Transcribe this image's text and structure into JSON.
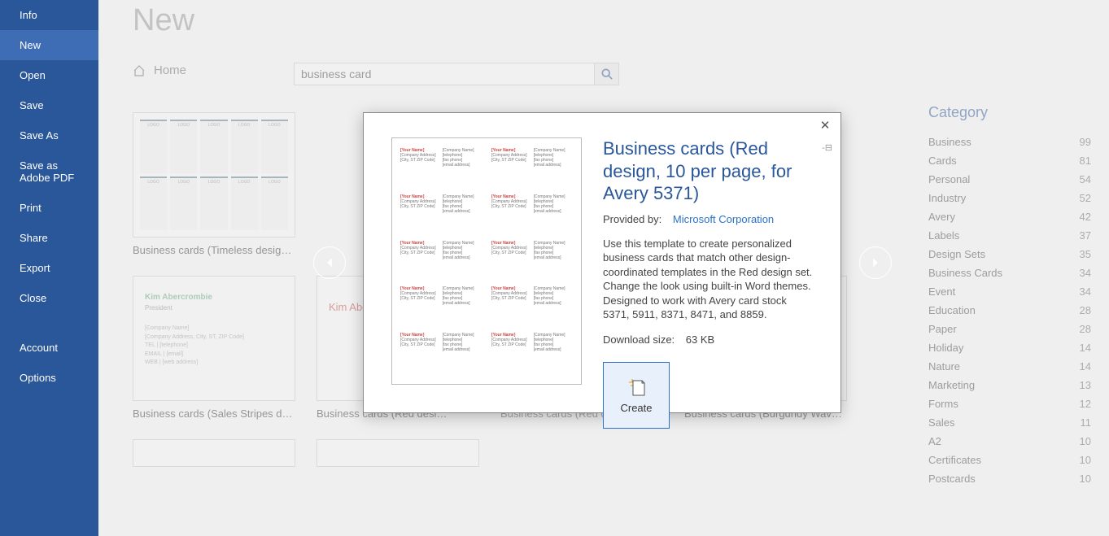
{
  "sidebar": {
    "items": [
      {
        "label": "Info",
        "id": "info"
      },
      {
        "label": "New",
        "id": "new",
        "active": true
      },
      {
        "label": "Open",
        "id": "open"
      },
      {
        "label": "Save",
        "id": "save"
      },
      {
        "label": "Save As",
        "id": "save-as"
      },
      {
        "label": "Save as Adobe PDF",
        "id": "save-adobe-pdf"
      },
      {
        "label": "Print",
        "id": "print"
      },
      {
        "label": "Share",
        "id": "share"
      },
      {
        "label": "Export",
        "id": "export"
      },
      {
        "label": "Close",
        "id": "close"
      }
    ],
    "secondary": [
      {
        "label": "Account",
        "id": "account"
      },
      {
        "label": "Options",
        "id": "options"
      }
    ]
  },
  "page": {
    "title": "New"
  },
  "breadcrumb": {
    "home": "Home"
  },
  "search": {
    "value": "business card"
  },
  "categories": {
    "title": "Category",
    "items": [
      {
        "name": "Business",
        "count": 99
      },
      {
        "name": "Cards",
        "count": 81
      },
      {
        "name": "Personal",
        "count": 54
      },
      {
        "name": "Industry",
        "count": 52
      },
      {
        "name": "Avery",
        "count": 42
      },
      {
        "name": "Labels",
        "count": 37
      },
      {
        "name": "Design Sets",
        "count": 35
      },
      {
        "name": "Business Cards",
        "count": 34
      },
      {
        "name": "Event",
        "count": 34
      },
      {
        "name": "Education",
        "count": 28
      },
      {
        "name": "Paper",
        "count": 28
      },
      {
        "name": "Holiday",
        "count": 14
      },
      {
        "name": "Nature",
        "count": 14
      },
      {
        "name": "Marketing",
        "count": 13
      },
      {
        "name": "Forms",
        "count": 12
      },
      {
        "name": "Sales",
        "count": 11
      },
      {
        "name": "A2",
        "count": 10
      },
      {
        "name": "Certificates",
        "count": 10
      },
      {
        "name": "Postcards",
        "count": 10
      }
    ]
  },
  "gallery": {
    "row1": [
      {
        "caption": "Business cards (Timeless design,…"
      },
      {
        "caption": ""
      },
      {
        "caption": ""
      },
      {
        "caption": ""
      }
    ],
    "row2": [
      {
        "caption": "Business cards (Sales Stripes desi…"
      },
      {
        "caption": "Business cards (Red desi…"
      },
      {
        "caption": "Business cards (Red design, 10 p…",
        "selected": true
      },
      {
        "caption": "Business cards (Burgundy Wave…"
      }
    ]
  },
  "sample": {
    "name": "Kim Abercrombie",
    "role": "President",
    "l1": "[Company Name]",
    "l2": "[Company Address, City, ST, ZIP Code]",
    "l3": "TEL | [telephone]",
    "l4": "EMAIL | [email]",
    "l5": "WEB | [web address]",
    "short": "Kim Abercrombie"
  },
  "modal": {
    "title": "Business cards (Red design, 10 per page, for Avery 5371)",
    "providedByLabel": "Provided by:",
    "provider": "Microsoft Corporation",
    "description": "Use this template to create personalized business cards that match other design-coordinated templates in the Red design set. Change the look using built-in Word themes. Designed to work with Avery card stock 5371, 5911, 8371, 8471, and 8859.",
    "dlLabel": "Download size:",
    "dlSize": "63 KB",
    "createLabel": "Create",
    "previewCell": {
      "name": "[Your Name]",
      "comp": "[Company Name]",
      "addr": "[Company Address]",
      "city": "[City, ST ZIP Code]",
      "tel": "[telephone]",
      "fax": "[fax phone]",
      "mail": "[email address]"
    }
  }
}
